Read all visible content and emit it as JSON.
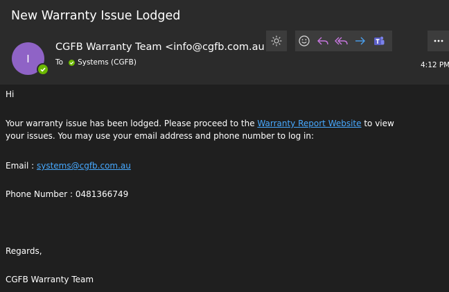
{
  "email": {
    "subject": "New Warranty Issue Lodged",
    "avatar_initial": "I",
    "sender": "CGFB Warranty Team <info@cgfb.com.au>",
    "to_label": "To",
    "recipient": "Systems (CGFB)",
    "time": "4:12 PM"
  },
  "toolbar": {
    "icons": [
      "sun-icon",
      "emoji-icon",
      "reply-icon",
      "reply-all-icon",
      "forward-icon",
      "teams-icon",
      "more-icon"
    ]
  },
  "body": {
    "greeting": "Hi",
    "line1_pre": "Your warranty issue has been lodged. Please proceed to the ",
    "link_text": "Warranty Report Website",
    "line1_post": " to view",
    "line2": "your issues. You may use your email address and phone number to log in:",
    "email_label": "Email : ",
    "email_value": "systems@cgfb.com.au",
    "phone_label": "Phone Number : ",
    "phone_value": "0481366749",
    "regards": "Regards,",
    "signature": "CGFB Warranty Team"
  },
  "colors": {
    "background": "#1f1f1f",
    "header": "#2b2b2b",
    "button": "#3c3c3c",
    "link": "#47a9ff",
    "avatar": "#8f63c6",
    "presence": "#6bb700",
    "reply_icons": "#c777e0",
    "forward_icon": "#4aa0f0",
    "teams": "#5b5fc7"
  }
}
